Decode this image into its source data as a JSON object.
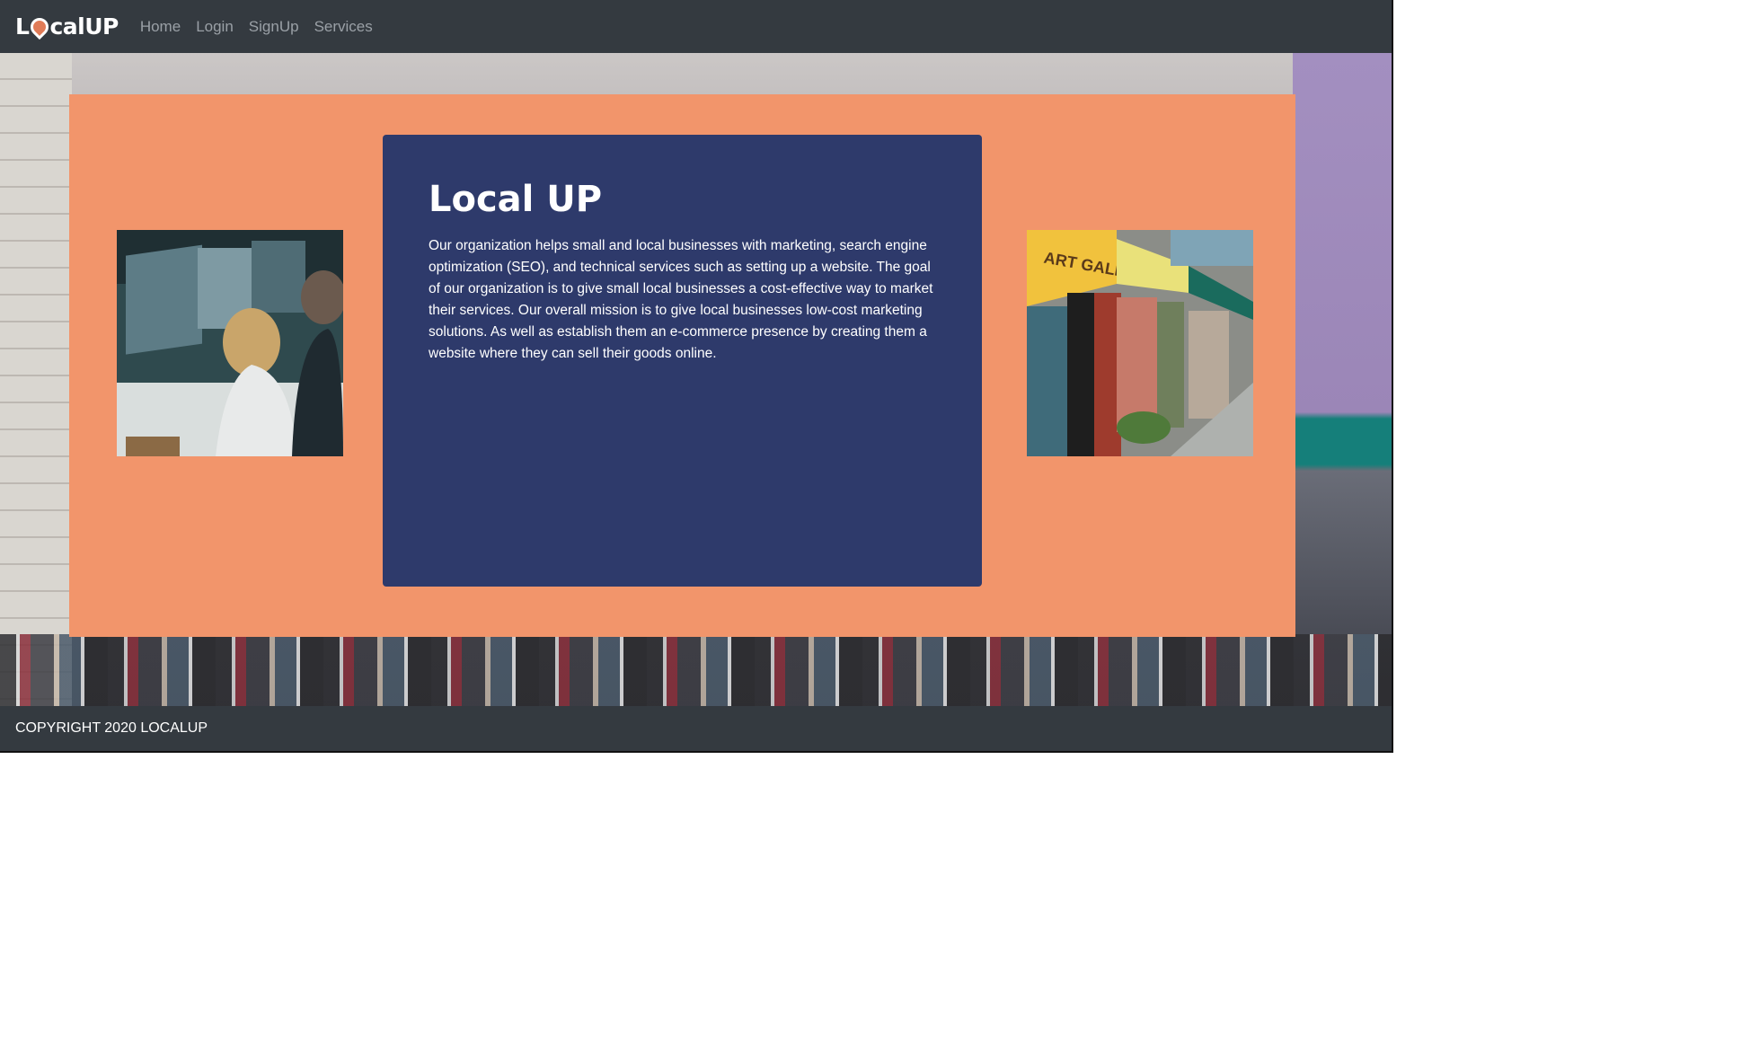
{
  "navbar": {
    "brand": {
      "prefix": "L",
      "suffix": "calUP"
    },
    "links": [
      "Home",
      "Login",
      "SignUp",
      "Services"
    ]
  },
  "main": {
    "title": "Local UP",
    "body": "Our organization helps small and local businesses with marketing, search engine optimization (SEO), and technical services such as setting up a website. The goal of our organization is to give small local businesses a cost-effective way to market their services. Our overall mission is to give local businesses low-cost marketing solutions. As well as establish them an e-commerce presence by creating them a website where they can sell their goods online."
  },
  "footer": {
    "copyright": "COPYRIGHT 2020 LOCALUP"
  },
  "colors": {
    "navbar": "#343a40",
    "panel": "#f2956b",
    "card": "#2e3a6b",
    "nav_link": "#9aa0a6"
  },
  "icons": {
    "brand_pin": "map-pin-icon"
  }
}
